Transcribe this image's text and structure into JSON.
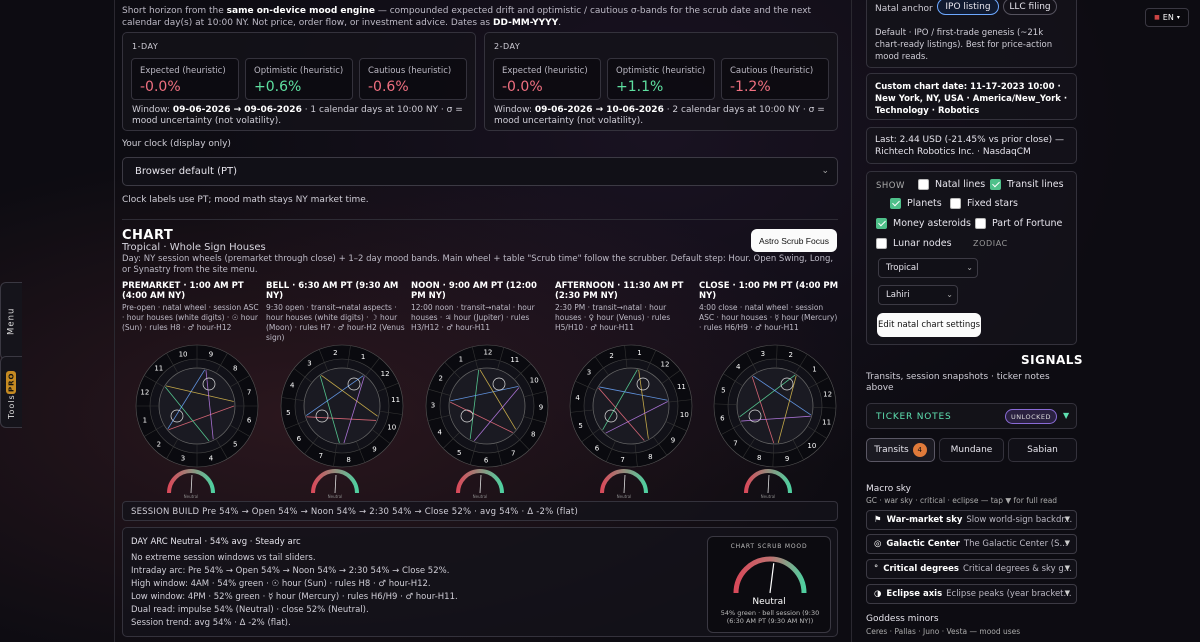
{
  "side": {
    "menu": "Menu",
    "tools": "Tools",
    "pro": "PRO"
  },
  "intro": {
    "p1": "Short horizon from the ",
    "engine": "same on-device mood engine",
    "p2": " — compounded expected drift and optimistic / cautious σ-bands for the scrub date and the next calendar day(s) at 10:00 NY. Not price, order flow, or investment advice. Dates as ",
    "fmt": "DD-MM-YYYY",
    "p3": "."
  },
  "horizons": [
    {
      "title": "1-DAY",
      "expected_label": "Expected (heuristic)",
      "expected": "-0.0%",
      "optimistic_label": "Optimistic (heuristic)",
      "optimistic": "+0.6%",
      "cautious_label": "Cautious (heuristic)",
      "cautious": "-0.6%",
      "win_pre": "Window: ",
      "win_range": "09-06-2026 → 09-06-2026",
      "win_post": " · 1 calendar days at 10:00 NY · σ =",
      "win_line2": "mood uncertainty (not volatility)."
    },
    {
      "title": "2-DAY",
      "expected_label": "Expected (heuristic)",
      "expected": "-0.0%",
      "optimistic_label": "Optimistic (heuristic)",
      "optimistic": "+1.1%",
      "cautious_label": "Cautious (heuristic)",
      "cautious": "-1.2%",
      "win_pre": "Window: ",
      "win_range": "09-06-2026 → 10-06-2026",
      "win_post": " · 2 calendar days at 10:00 NY · σ =",
      "win_line2": "mood uncertainty (not volatility)."
    }
  ],
  "clock": {
    "label": "Your clock (display only)",
    "value": "Browser default (PT)",
    "note": "Clock labels use PT; mood math stays NY market time."
  },
  "chart": {
    "heading": "CHART",
    "subtitle": "Tropical · Whole Sign Houses",
    "focus_btn": "Astro Scrub Focus",
    "desc": "Day: NY session wheels (premarket through close) + 1–2 day mood bands. Main wheel + table \"Scrub time\" follow the scrubber. Default step: Hour. Open Swing, Long, or Synastry from the site menu.",
    "sessions": [
      {
        "title": "PREMARKET · 1:00 AM PT (4:00 AM NY)",
        "desc": "Pre-open · natal wheel · session ASC · hour houses (white digits) · ☉ hour (Sun) · rules H8 · ♂ hour-H12",
        "gauge": "Neutral"
      },
      {
        "title": "BELL · 6:30 AM PT (9:30 AM NY)",
        "desc": "9:30 open · transit→natal aspects · hour houses (white digits) · ☽ hour (Moon) · rules H7 · ♂ hour-H2 (Venus sign)",
        "gauge": "Neutral"
      },
      {
        "title": "NOON · 9:00 AM PT (12:00 PM NY)",
        "desc": "12:00 noon · transit→natal · hour houses · ♃ hour (Jupiter) · rules H3/H12 · ♂ hour-H11",
        "gauge": "Neutral"
      },
      {
        "title": "AFTERNOON · 11:30 AM PT (2:30 PM NY)",
        "desc": "2:30 PM · transit→natal · hour houses · ♀ hour (Venus) · rules H5/H10 · ♂ hour-H11",
        "gauge": "Neutral"
      },
      {
        "title": "CLOSE · 1:00 PM PT (4:00 PM NY)",
        "desc": "4:00 close · natal wheel · session ASC · hour houses · ☿ hour (Mercury) · rules H6/H9 · ♂ hour-H11",
        "gauge": "Neutral"
      }
    ],
    "wheel_numbers": [
      [
        "9",
        "8",
        "7",
        "6",
        "5",
        "4",
        "3",
        "2",
        "1",
        "12",
        "11",
        "10"
      ],
      [
        "1",
        "12",
        "11",
        "10",
        "9",
        "8",
        "7",
        "6",
        "5",
        "4",
        "3",
        "2"
      ],
      [
        "11",
        "10",
        "9",
        "8",
        "7",
        "6",
        "5",
        "4",
        "3",
        "2",
        "1",
        "12"
      ],
      [
        "12",
        "11",
        "10",
        "9",
        "8",
        "7",
        "6",
        "5",
        "4",
        "3",
        "2",
        "1"
      ],
      [
        "1",
        "12",
        "11",
        "10",
        "9",
        "8",
        "7",
        "6",
        "5",
        "4",
        "3",
        "2"
      ]
    ],
    "session_build": "SESSION BUILD   Pre 54% → Open 54% → Noon 54% → 2:30 54% → Close 52% · avg 54% · Δ -2% (flat)"
  },
  "dayarc": {
    "title": "DAY ARC   Neutral · 54% avg · Steady arc",
    "lines": [
      "No extreme session windows vs tail sliders.",
      "Intraday arc: Pre 54% → Open 54% → Noon 54% → 2:30 54% → Close 52%.",
      "High window: 4AM · 54% green · ☉ hour (Sun) · rules H8 · ♂ hour-H12.",
      "Low window: 4PM · 52% green · ☿ hour (Mercury) · rules H6/H9 · ♂ hour-H11.",
      "Dual read: impulse 54% (Neutral) · close 52% (Neutral).",
      "Session trend: avg 54% · Δ -2% (flat)."
    ],
    "scrub_header": "CHART SCRUB MOOD",
    "scrub_mood": "Neutral",
    "scrub_sub": "54% green · bell session (9:30 (6:30 AM PT (9:30 AM NY))",
    "scrub_level": 0.54
  },
  "right": {
    "anchor_label": "Natal anchor",
    "chip_ipo": "IPO listing",
    "chip_llc": "LLC filing",
    "anchor_desc": "Default · IPO / first-trade genesis (~21k chart-ready listings). Best for price-action mood reads.",
    "custom_chart": "Custom chart date: 11-17-2023 10:00 · New York, NY, USA · America/New_York · Technology · Robotics",
    "last_price": "Last: 2.44 USD (-21.45% vs prior close) — Richtech Robotics Inc. · NasdaqCM",
    "show_label": "SHOW",
    "opts": {
      "natal": "Natal lines",
      "transit": "Transit lines",
      "planets": "Planets",
      "fixed": "Fixed stars",
      "money": "Money asteroids",
      "fortune": "Part of Fortune",
      "lunar": "Lunar nodes",
      "zodiac": "ZODIAC"
    },
    "zodiac_select": "Tropical",
    "ayanamsa_select": "Lahiri",
    "edit_btn": "Edit natal chart settings",
    "signals_heading": "SIGNALS",
    "signals_sub": "Transits, session snapshots · ticker notes above",
    "ticker_notes": "TICKER NOTES",
    "unlocked": "UNLOCKED",
    "tabs": {
      "transits": "Transits",
      "transits_count": "4",
      "mundane": "Mundane",
      "sabian": "Sabian"
    },
    "macro_title": "Macro sky",
    "macro_sub": "GC · war sky · critical · eclipse — tap ▼ for full read",
    "macro_items": [
      {
        "icon": "⚑",
        "name": "War-market sky",
        "desc": "Slow world-sign backdr..."
      },
      {
        "icon": "◎",
        "name": "Galactic Center",
        "desc": "The Galactic Center (S..."
      },
      {
        "icon": "°",
        "name": "Critical degrees",
        "desc": "Critical degrees & sky g..."
      },
      {
        "icon": "◑",
        "name": "Eclipse axis",
        "desc": "Eclipse peaks (year bracket..."
      }
    ],
    "goddess_title": "Goddess minors",
    "goddess_sub": "Ceres · Pallas · Juno · Vesta — mood uses"
  },
  "lang": "EN",
  "colors": {
    "accent_blue": "#6da8ff",
    "green": "#5ee0a0",
    "red": "#f07080",
    "orange": "#e07a3a"
  }
}
